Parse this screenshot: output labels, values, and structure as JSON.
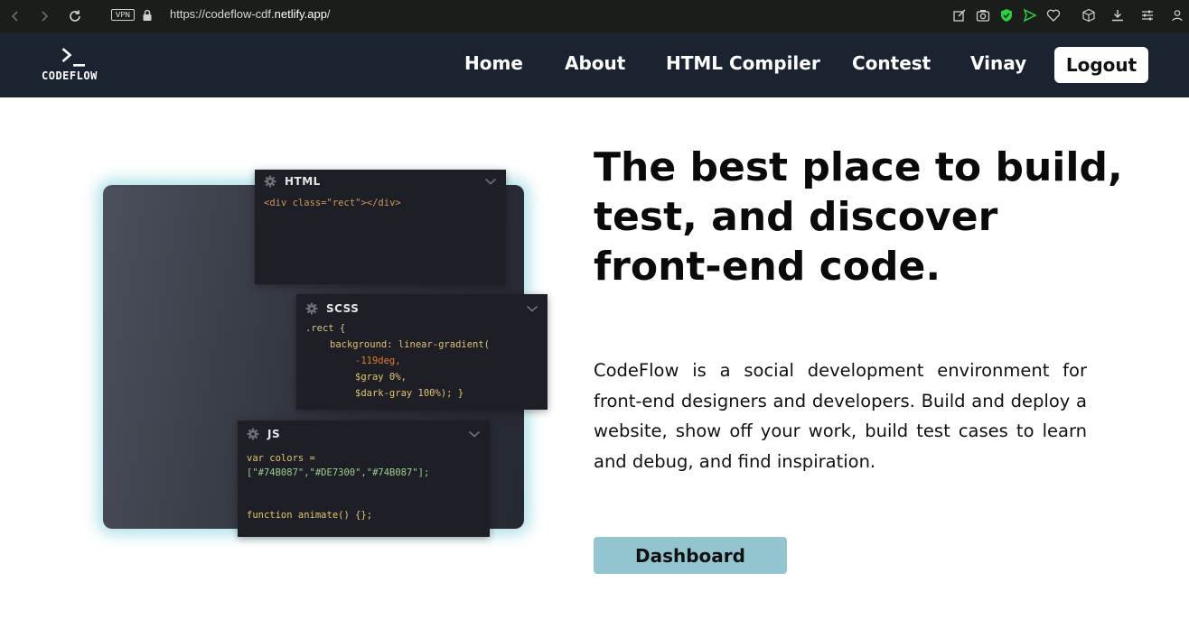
{
  "browser": {
    "vpn_label": "VPN",
    "url_prefix": "https://codeflow-cdf.",
    "url_host": "netlify.app",
    "url_suffix": "/"
  },
  "site_nav": {
    "logo_text": "CODEFLOW",
    "links": [
      "Home",
      "About",
      "HTML Compiler",
      "Contest",
      "Vinay"
    ],
    "logout_label": "Logout"
  },
  "illustration": {
    "html_card": {
      "title": "HTML",
      "code": [
        "<div class=\"rect\"></div>"
      ]
    },
    "scss_card": {
      "title": "SCSS",
      "code": [
        ".rect {",
        "background: linear-gradient(",
        "-119deg,",
        "$gray 0%,",
        "$dark-gray 100%); }"
      ]
    },
    "js_card": {
      "title": "JS",
      "code": [
        "var colors =",
        "[\"#74B087\",\"#DE7300\",\"#74B087\"];",
        "function animate() {};"
      ]
    }
  },
  "hero": {
    "headline": "The best place to build, test, and discover front-end code.",
    "description": "CodeFlow is a social development environment for front-end designers and developers. Build and deploy a website, show off your work, build test cases to learn and debug, and find inspiration.",
    "dashboard_label": "Dashboard"
  },
  "colors": {
    "browser_bar": "#1a1d1a",
    "site_nav": "#1c2330",
    "dashboard_button": "#93c5d0",
    "panel_glow": "#6ec8d7",
    "shield_green": "#2ecc40"
  },
  "icons": [
    "back-arrow-icon",
    "forward-arrow-icon",
    "reload-icon",
    "lock-icon",
    "edit-icon",
    "camera-icon",
    "shield-icon",
    "send-icon",
    "heart-icon",
    "cube-icon",
    "download-icon",
    "settings-sliders-icon",
    "user-icon",
    "gear-icon",
    "chevron-down-icon"
  ]
}
